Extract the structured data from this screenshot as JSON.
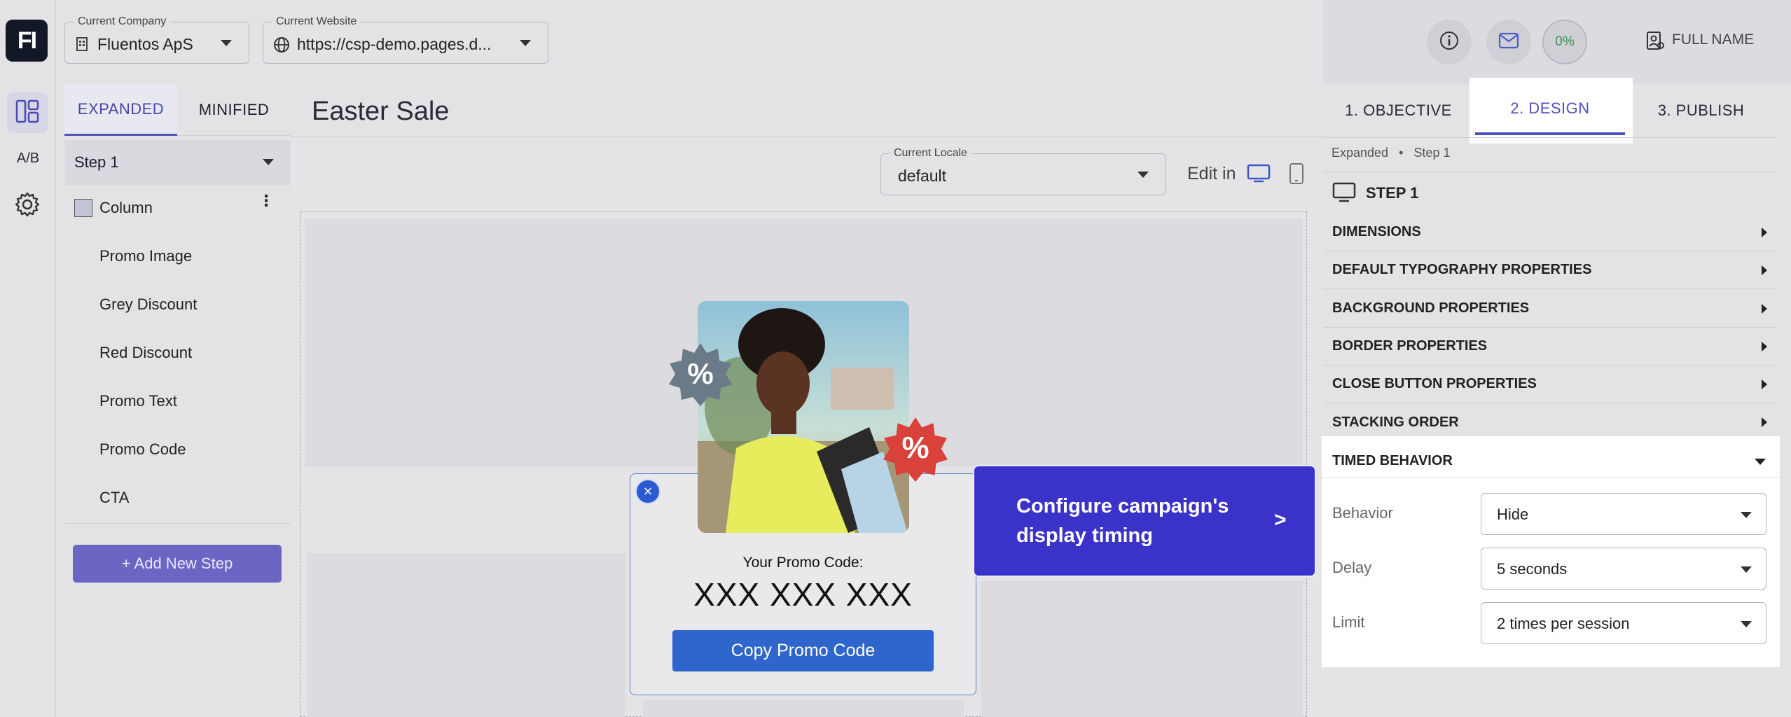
{
  "app": {
    "logo_text": "FI",
    "user_name": "FULL NAME",
    "progress_label": "0%",
    "progress_value": 0
  },
  "rail": {
    "ab_label": "A/B"
  },
  "top": {
    "company_legend": "Current Company",
    "company_value": "Fluentos ApS",
    "website_legend": "Current Website",
    "website_value": "https://csp-demo.pages.d..."
  },
  "left_panel": {
    "tabs": [
      "EXPANDED",
      "MINIFIED"
    ],
    "active_tab": "EXPANDED",
    "step_select": "Step 1",
    "tree": [
      "Column",
      "Promo Image",
      "Grey Discount",
      "Red Discount",
      "Promo Text",
      "Promo Code",
      "CTA"
    ],
    "add_step": "+ Add New Step"
  },
  "main": {
    "title": "Easter Sale",
    "locale_legend": "Current Locale",
    "locale_value": "default",
    "edit_in": "Edit in"
  },
  "popup": {
    "badge_symbol": "%",
    "promo_label": "Your Promo Code:",
    "promo_code": "XXX XXX XXX",
    "copy_button": "Copy Promo Code",
    "close_symbol": "×"
  },
  "tooltip": {
    "text": "Configure campaign's display timing",
    "arrow": ">"
  },
  "right_panel": {
    "tabs": [
      "1. OBJECTIVE",
      "2. DESIGN",
      "3. PUBLISH"
    ],
    "active_tab": "2. DESIGN",
    "breadcrumb": [
      "Expanded",
      "Step 1"
    ],
    "breadcrumb_sep": "•",
    "step_title": "STEP 1",
    "sections": [
      "DIMENSIONS",
      "DEFAULT TYPOGRAPHY PROPERTIES",
      "BACKGROUND PROPERTIES",
      "BORDER PROPERTIES",
      "CLOSE BUTTON PROPERTIES",
      "STACKING ORDER"
    ],
    "timed": {
      "title": "TIMED BEHAVIOR",
      "fields": [
        {
          "label": "Behavior",
          "value": "Hide"
        },
        {
          "label": "Delay",
          "value": "5 seconds"
        },
        {
          "label": "Limit",
          "value": "2 times per session"
        }
      ]
    }
  },
  "colors": {
    "accent": "#5050c0",
    "tooltip_bg": "#3b33c9",
    "copy_button_bg": "#2e66cc",
    "badge_grey": "#6b7a88",
    "badge_red": "#d8423a"
  },
  "icons": [
    "grid-layout-icon",
    "gear-icon",
    "building-icon",
    "globe-icon",
    "info-icon",
    "mail-icon",
    "user-badge-icon",
    "desktop-icon",
    "mobile-icon",
    "kebab-icon",
    "close-icon"
  ]
}
